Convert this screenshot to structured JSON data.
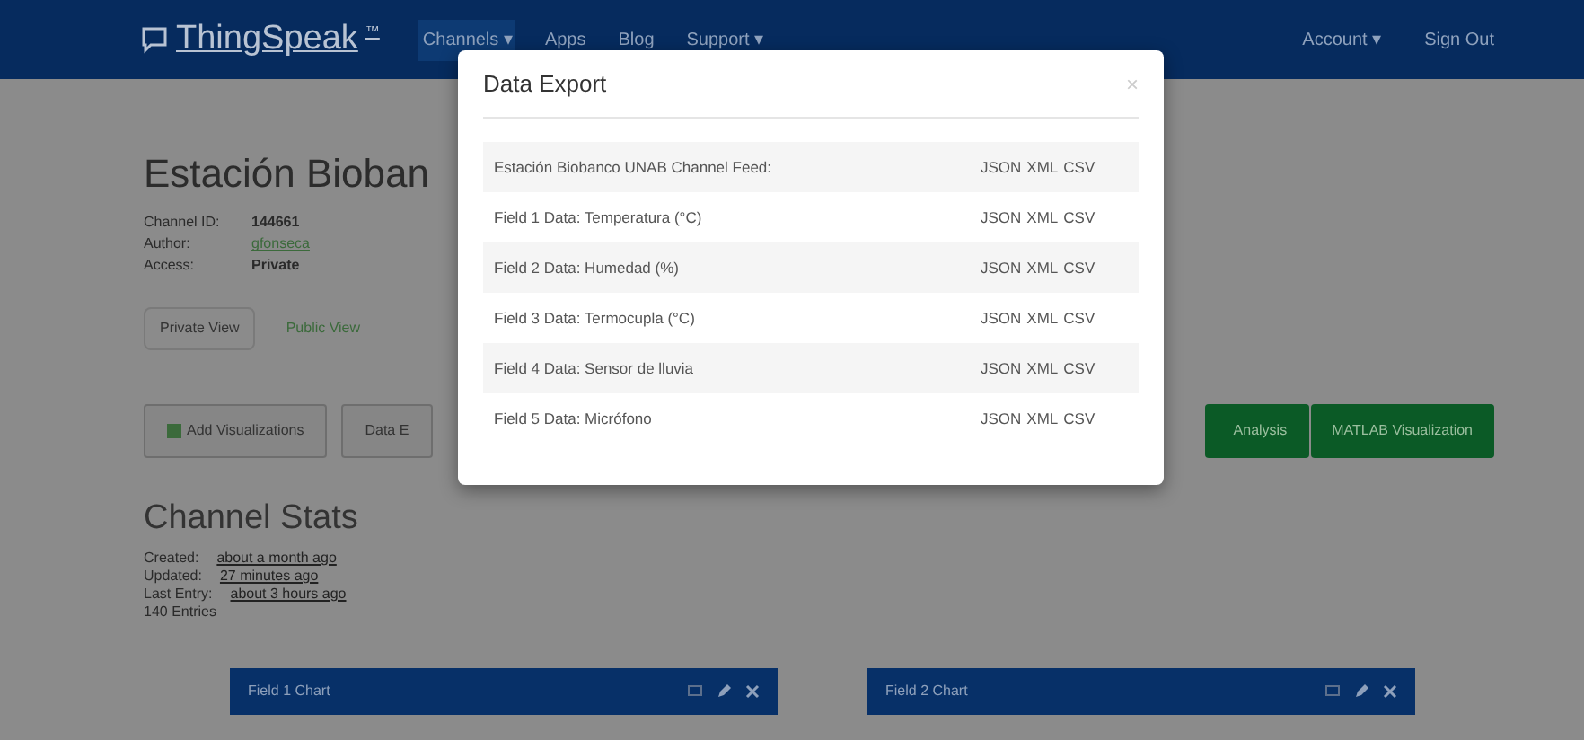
{
  "navbar": {
    "brand": "ThingSpeak",
    "brand_mark": "™",
    "left_items": [
      {
        "label": "Channels ▾",
        "selected": true
      },
      {
        "label": "Apps",
        "selected": false
      },
      {
        "label": "Blog",
        "selected": false
      },
      {
        "label": "Support ▾",
        "selected": false
      }
    ],
    "right_items": [
      "Account ▾",
      "Sign Out"
    ]
  },
  "channel": {
    "title": "Estación Bioban",
    "details": [
      {
        "label": "Channel ID:",
        "value": "144661",
        "kind": "text"
      },
      {
        "label": "Author:",
        "value": "gfonseca",
        "kind": "link"
      },
      {
        "label": "Access:",
        "value": "Private",
        "kind": "text"
      }
    ]
  },
  "tabs": [
    {
      "label": "Private View",
      "selected": true
    },
    {
      "label": "Public View",
      "selected": false
    }
  ],
  "toolbar": {
    "left_buttons": [
      "Add Visualizations",
      "Data E"
    ],
    "right_buttons": [
      "Analysis",
      "MATLAB Visualization"
    ]
  },
  "stats": {
    "title": "Channel Stats",
    "rows": [
      {
        "label": "Created:",
        "value": "about a month ago"
      },
      {
        "label": "Updated:",
        "value": "27 minutes ago"
      },
      {
        "label": "Last Entry:",
        "value": "about 3 hours ago"
      }
    ],
    "entries": "140 Entries"
  },
  "charts": [
    {
      "title": "Field 1 Chart"
    },
    {
      "title": "Field 2 Chart"
    }
  ],
  "modal": {
    "title": "Data Export",
    "close": "×",
    "rows": [
      {
        "label": "Estación Biobanco UNAB Channel Feed:",
        "formats": [
          "JSON",
          "XML",
          "CSV"
        ]
      },
      {
        "label": "Field 1 Data: Temperatura (°C)",
        "formats": [
          "JSON",
          "XML",
          "CSV"
        ]
      },
      {
        "label": "Field 2 Data: Humedad (%)",
        "formats": [
          "JSON",
          "XML",
          "CSV"
        ]
      },
      {
        "label": "Field 3 Data: Termocupla (°C)",
        "formats": [
          "JSON",
          "XML",
          "CSV"
        ]
      },
      {
        "label": "Field 4 Data: Sensor de lluvia",
        "formats": [
          "JSON",
          "XML",
          "CSV"
        ]
      },
      {
        "label": "Field 5 Data: Micrófono",
        "formats": [
          "JSON",
          "XML",
          "CSV"
        ]
      }
    ]
  }
}
